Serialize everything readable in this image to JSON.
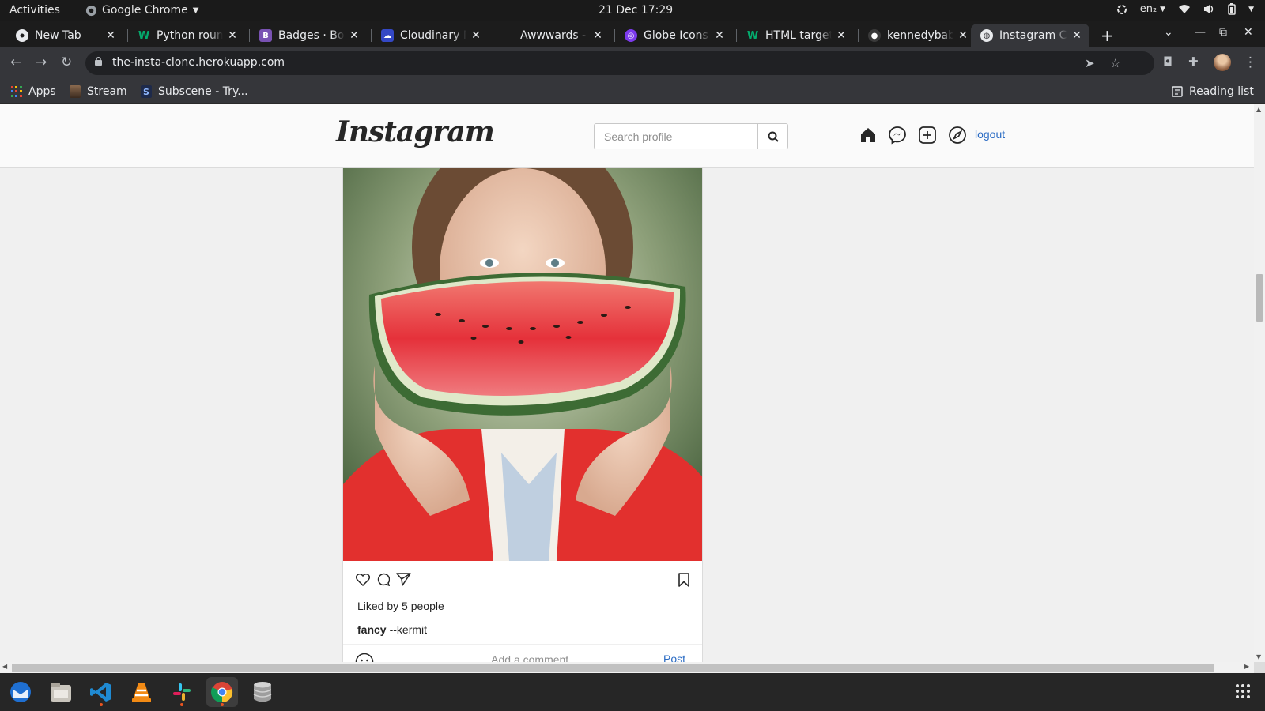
{
  "system": {
    "activities": "Activities",
    "app_menu": "Google Chrome",
    "clock": "21 Dec  17:29",
    "keyboard_layout": "en₂"
  },
  "tabs": [
    {
      "title": "New Tab",
      "icon": "chrome-icon"
    },
    {
      "title": "Python round",
      "icon": "w3schools-icon"
    },
    {
      "title": "Badges · Boo",
      "icon": "bootstrap-icon"
    },
    {
      "title": "Cloudinary M",
      "icon": "cloudinary-icon"
    },
    {
      "title": "Awwwards -",
      "icon": "awwwards-icon"
    },
    {
      "title": "Globe Icons |",
      "icon": "globe-icon"
    },
    {
      "title": "HTML target",
      "icon": "w3schools-icon"
    },
    {
      "title": "kennedybabu",
      "icon": "github-icon"
    },
    {
      "title": "Instagram Cl",
      "icon": "globe-icon",
      "active": true
    }
  ],
  "browser": {
    "url": "the-insta-clone.herokuapp.com",
    "bookmarks": [
      "Apps",
      "Stream",
      "Subscene - Try..."
    ],
    "reading_list": "Reading list"
  },
  "page": {
    "logo": "Instagram",
    "search_placeholder": "Search profile",
    "logout": "logout",
    "post": {
      "likes_text": "Liked by 5 people",
      "caption_user": "fancy",
      "caption_text": "--kermit",
      "comment_placeholder": "Add a comment...",
      "post_button": "Post"
    }
  },
  "colors": {
    "link_blue": "#2b6cc4",
    "dock_active_dot": "#e95420"
  }
}
